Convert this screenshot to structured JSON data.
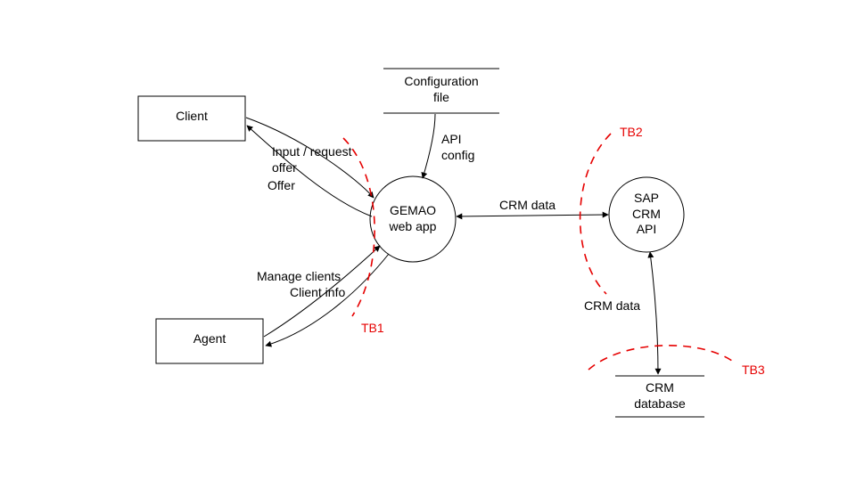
{
  "entities": {
    "client": "Client",
    "agent": "Agent",
    "config": "Configuration\nfile",
    "gemao": "GEMAO\nweb app",
    "sap": "SAP\nCRM\nAPI",
    "crmdb": "CRM\ndatabase"
  },
  "flows": {
    "input_request": "Input / request\noffer",
    "offer": "Offer",
    "api_config": "API\nconfig",
    "crm_data_1": "CRM data",
    "manage_clients": "Manage clients",
    "client_info": "Client info",
    "crm_data_2": "CRM data"
  },
  "boundaries": {
    "tb1": "TB1",
    "tb2": "TB2",
    "tb3": "TB3"
  }
}
